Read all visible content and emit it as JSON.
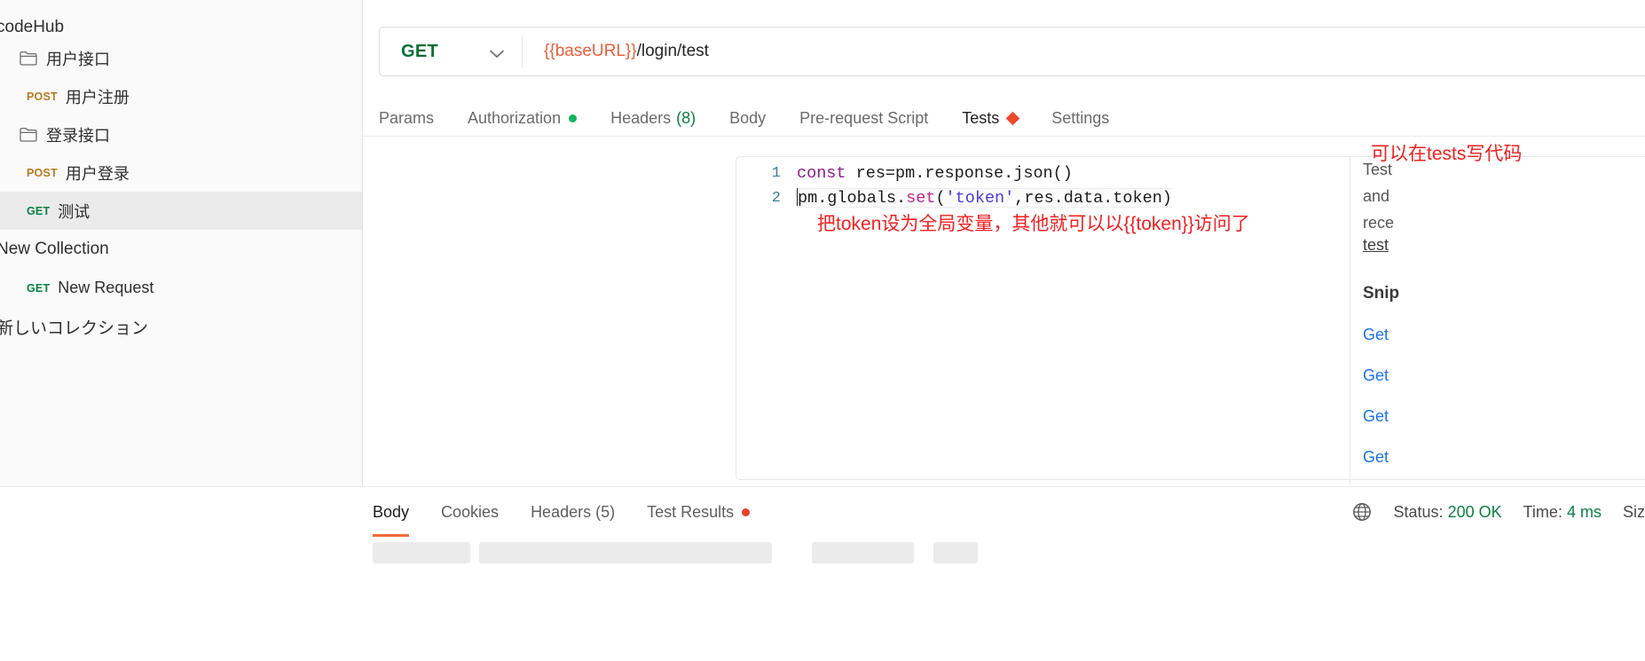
{
  "sidebar": {
    "collections": [
      {
        "name": "codeHub",
        "items": [
          {
            "type": "folder",
            "icon": "folder-icon",
            "label": "用户接口",
            "indent": 1
          },
          {
            "type": "request",
            "method": "POST",
            "label": "用户注册",
            "indent": 2,
            "selected": false
          },
          {
            "type": "folder",
            "icon": "folder-icon",
            "label": "登录接口",
            "indent": 1
          },
          {
            "type": "request",
            "method": "POST",
            "label": "用户登录",
            "indent": 2,
            "selected": false
          },
          {
            "type": "request",
            "method": "GET",
            "label": "测试",
            "indent": 2,
            "selected": true
          }
        ]
      },
      {
        "name": "New Collection",
        "items": [
          {
            "type": "request",
            "method": "GET",
            "label": "New Request",
            "indent": 2,
            "selected": false
          }
        ]
      },
      {
        "name": "新しいコレクション",
        "items": []
      }
    ]
  },
  "request": {
    "method": "GET",
    "method_chevron": "chevron-down-icon",
    "url_variable": "{{baseURL}}",
    "url_path": "/login/test",
    "tabs": [
      {
        "label": "Params",
        "active": false,
        "marker": "none"
      },
      {
        "label": "Authorization",
        "active": false,
        "marker": "green-dot"
      },
      {
        "label": "Headers",
        "count": "(8)",
        "active": false,
        "marker": "count"
      },
      {
        "label": "Body",
        "active": false,
        "marker": "none"
      },
      {
        "label": "Pre-request Script",
        "active": false,
        "marker": "none"
      },
      {
        "label": "Tests",
        "active": true,
        "marker": "red-diamond"
      },
      {
        "label": "Settings",
        "active": false,
        "marker": "none"
      }
    ]
  },
  "editor": {
    "magic_icon": "sparkle-wand-icon",
    "lines": [
      {
        "number": "1",
        "active": false,
        "tokens": [
          {
            "text": "const",
            "cls": "kw"
          },
          {
            "text": " res=pm.response.json()",
            "cls": ""
          }
        ]
      },
      {
        "number": "2",
        "active": true,
        "tokens": [
          {
            "text": "pm.globals.",
            "cls": ""
          },
          {
            "text": "set",
            "cls": "fn"
          },
          {
            "text": "(",
            "cls": ""
          },
          {
            "text": "'token'",
            "cls": "str"
          },
          {
            "text": ",res.data.token)",
            "cls": ""
          }
        ]
      }
    ]
  },
  "annotations": {
    "tests_note": "可以在tests写代码",
    "token_note": "把token设为全局变量，其他就可以以{{token}}访问了"
  },
  "response": {
    "tabs": [
      {
        "label": "Body",
        "active": true,
        "marker": "none"
      },
      {
        "label": "Cookies",
        "active": false,
        "marker": "none"
      },
      {
        "label": "Headers",
        "count": "(5)",
        "active": false,
        "marker": "none"
      },
      {
        "label": "Test Results",
        "active": false,
        "marker": "red-dot"
      }
    ],
    "globe_icon": "globe-icon",
    "status_label": "Status:",
    "status_value": "200 OK",
    "time_label": "Time:",
    "time_value": "4 ms",
    "size_label": "Siz"
  },
  "right_panel": {
    "intro_lines": [
      "Test",
      "and",
      "rece"
    ],
    "link": "test",
    "snippets_heading": "Snip",
    "snippets": [
      "Get",
      "Get",
      "Get",
      "Get"
    ]
  },
  "colors": {
    "accent_orange": "#f26b3a",
    "variable_red": "#e8603c",
    "annotation_red": "#f02020",
    "get_green": "#0b8043",
    "post_gold": "#b7791f",
    "link_blue": "#1a73e8"
  }
}
